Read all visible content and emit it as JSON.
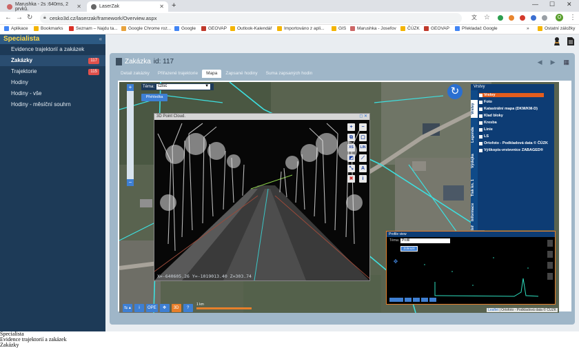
{
  "browser": {
    "tabs": [
      {
        "title": "Marushka - 2s :640ms, 2 prvků."
      },
      {
        "title": "LaserZak"
      }
    ],
    "new_tab": "+",
    "window_controls": {
      "minimize": "—",
      "maximize": "☐",
      "close": "✕"
    },
    "url": "cesko3d.cz/laserzak/framework/Overview.aspx",
    "avatar_letter": "O",
    "bookmarks": [
      {
        "label": "Aplikace",
        "color": "#4285f4"
      },
      {
        "label": "Bookmarks",
        "color": "#f4b400"
      },
      {
        "label": "Seznam – Najdu ta...",
        "color": "#d93025"
      },
      {
        "label": "Google Chrome roz...",
        "color": "#e8a33d"
      },
      {
        "label": "Google",
        "color": "#4285f4"
      },
      {
        "label": "GEOVAP",
        "color": "#c0392b"
      },
      {
        "label": "Outlook-Kalendář",
        "color": "#f4b400"
      },
      {
        "label": "Importováno z apli...",
        "color": "#f4b400"
      },
      {
        "label": "GIS",
        "color": "#f4b400"
      },
      {
        "label": "Marushka - Josefov",
        "color": "#c66"
      },
      {
        "label": "ČÚZK",
        "color": "#f4b400"
      },
      {
        "label": "GEOVAP",
        "color": "#c0392b"
      },
      {
        "label": "Překladač Google",
        "color": "#4285f4"
      }
    ],
    "bookmarks_more": "»",
    "other_bookmarks": "Ostatní záložky"
  },
  "sidebar": {
    "brand": "Specialista",
    "collapse_icon": "«",
    "items": [
      {
        "label": "Evidence trajektorií a zakázek",
        "badge": ""
      },
      {
        "label": "Zakázky",
        "badge": "117"
      },
      {
        "label": "Trajektorie",
        "badge": "115"
      },
      {
        "label": "Hodiny",
        "badge": ""
      },
      {
        "label": "Hodiny - vše",
        "badge": ""
      },
      {
        "label": "Hodiny - měsíční souhrn",
        "badge": ""
      }
    ]
  },
  "panel": {
    "title": "Zakázka",
    "id_label": "id: 117",
    "nav": {
      "prev": "◀",
      "next": "▶",
      "grid": "▦"
    },
    "tabs": [
      "Detail zakázky",
      "Přiřazené trajektorie",
      "Mapa",
      "Zapsané hodiny",
      "Suma zapsaných hodin"
    ],
    "active_tab": 2
  },
  "map": {
    "tema_label": "Téma:",
    "tema_value": "czlsc",
    "prehledka": "Přehledka",
    "layers_header": "Vrstvy",
    "vertical_tabs": [
      "Vrstvy",
      "Legenda",
      "Výdejka",
      "Tisk kn. 1",
      "Informace",
      "Info"
    ],
    "layers": [
      "Vrstvy",
      "Foto",
      "Katastrální mapa (DKM/KM-D)",
      "Klad bloky",
      "Kresba",
      "Linie",
      "LS",
      "Ortofoto - Podkladová data © ČÚZK",
      "Výškopis-vrstevnice ZABAGED®"
    ],
    "point_cloud": {
      "title": "3D Point Cloud.",
      "coords": "X=-640605.26 Y=-1019013.40 Z=303.74",
      "tools": [
        "+",
        "−",
        "⧉",
        "▢",
        "XS",
        "LIN",
        "◩",
        "⟋",
        "⤡",
        "A",
        "✖",
        "i"
      ]
    },
    "profile": {
      "title": "Profile view",
      "tema_label": "Téma:",
      "tema_value": "Profil",
      "button": "Zobrazit"
    },
    "bottom_tools": [
      "⇆ ▴",
      "i",
      "OPE",
      "✥",
      "3D",
      "?"
    ],
    "scale": "1 km",
    "attribution_link": "Leaflet",
    "attribution": "| Ortofoto - Podkladová data © ČÚZK"
  },
  "footer": [
    "Specialista",
    "Evidence trajektorií a zakázek",
    "Zakázky"
  ]
}
